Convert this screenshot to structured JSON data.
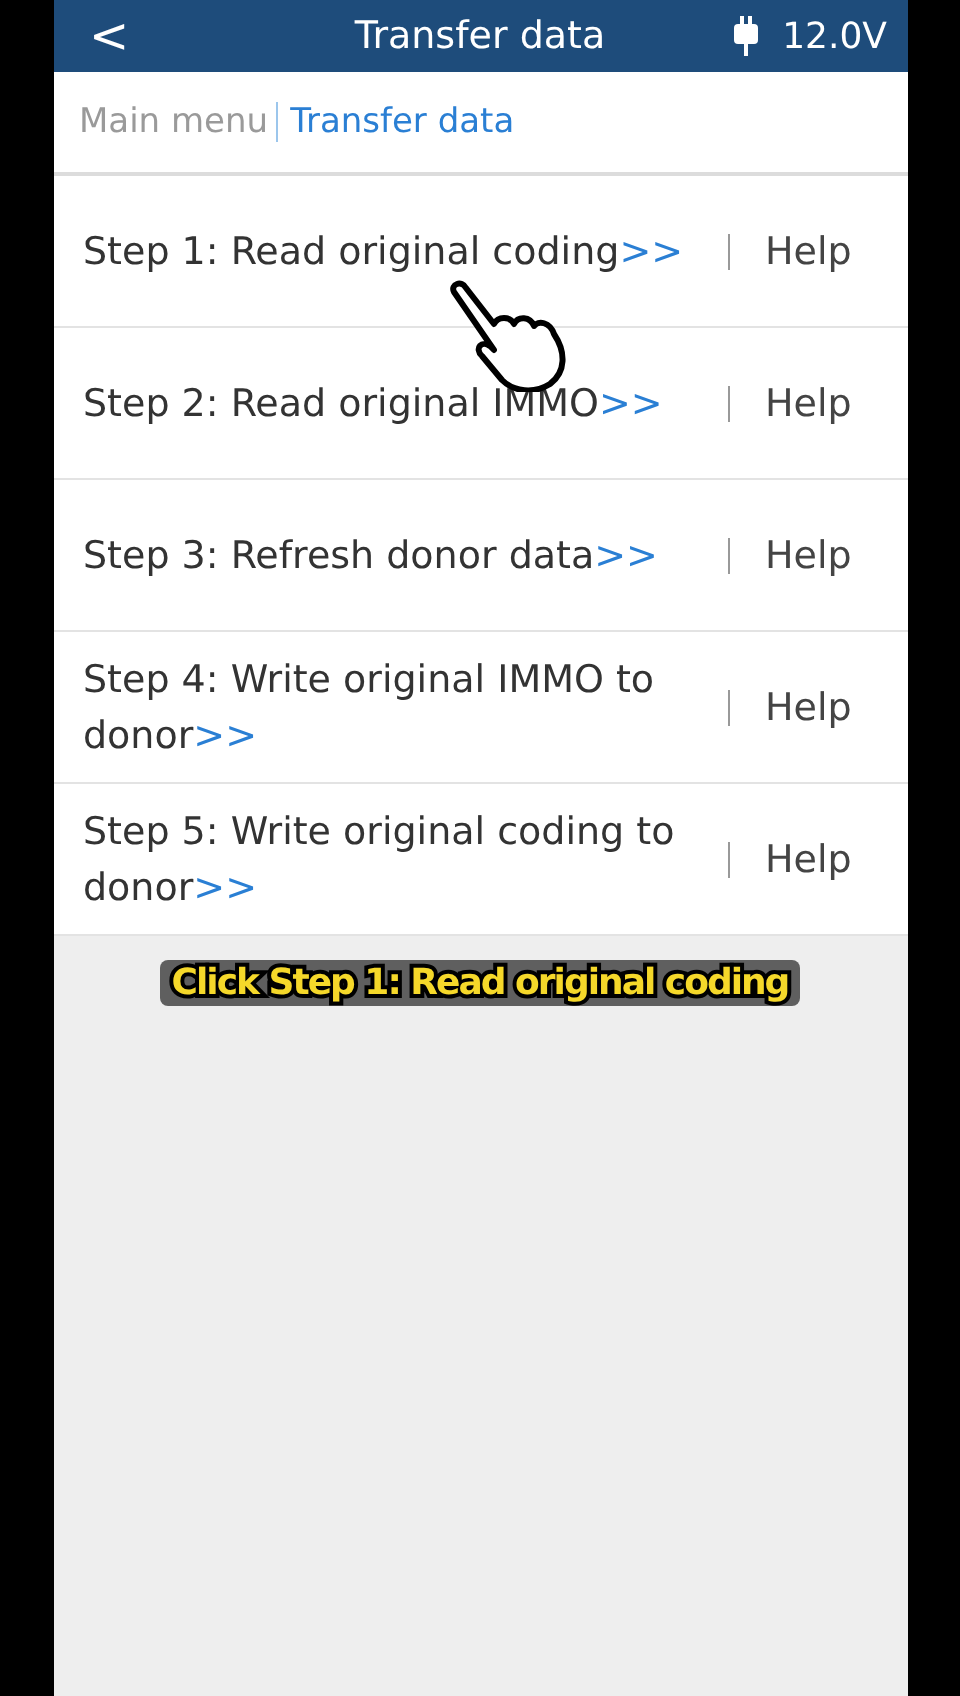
{
  "header": {
    "back": "<",
    "title": "Transfer data",
    "voltage": "12.0V"
  },
  "breadcrumb": [
    {
      "label": "Main menu",
      "selected": false
    },
    {
      "label": "Transfer data",
      "selected": true
    }
  ],
  "steps": [
    {
      "title": "Step 1: Read original coding",
      "arrow": ">>",
      "help": "Help"
    },
    {
      "title": "Step 2: Read original IMMO",
      "arrow": ">>",
      "help": "Help"
    },
    {
      "title": "Step 3: Refresh donor data",
      "arrow": ">>",
      "help": "Help"
    },
    {
      "title": "Step 4: Write original IMMO to donor",
      "arrow": ">>",
      "help": "Help"
    },
    {
      "title": "Step 5: Write original coding to donor",
      "arrow": ">>",
      "help": "Help"
    }
  ],
  "caption": "Click Step 1: Read original coding"
}
